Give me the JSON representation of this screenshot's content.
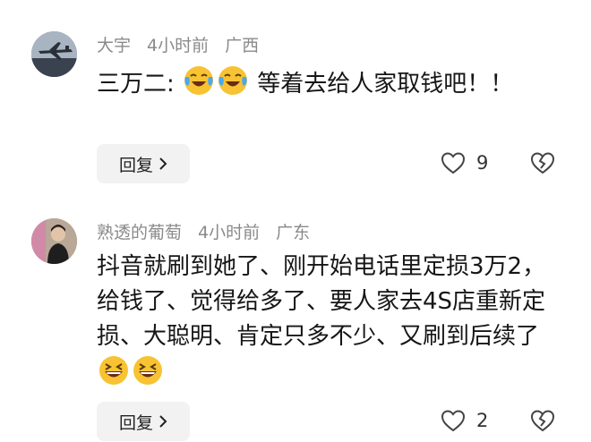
{
  "comments": [
    {
      "username": "大宇",
      "time": "4小时前",
      "location": "广西",
      "text_before": "三万二:",
      "emojis_before": [
        "laughing-crying-emoji",
        "laughing-crying-emoji"
      ],
      "text_after": "等着去给人家取钱吧！！",
      "reply_label": "回复",
      "like_count": "9"
    },
    {
      "username": "熟透的葡萄",
      "time": "4小时前",
      "location": "广东",
      "text": "抖音就刷到她了、刚开始电话里定损3万2，给钱了、觉得给多了、要人家去4S店重新定损、大聪明、肯定只多不少、又刷到后续了",
      "emojis_after": [
        "grinning-squint-emoji",
        "grinning-squint-emoji"
      ],
      "reply_label": "回复",
      "like_count": "2"
    }
  ],
  "colors": {
    "meta_text": "#8a8a8a",
    "body_text": "#161616",
    "button_bg": "#f2f2f2",
    "emoji_yellow": "#f7c333"
  }
}
